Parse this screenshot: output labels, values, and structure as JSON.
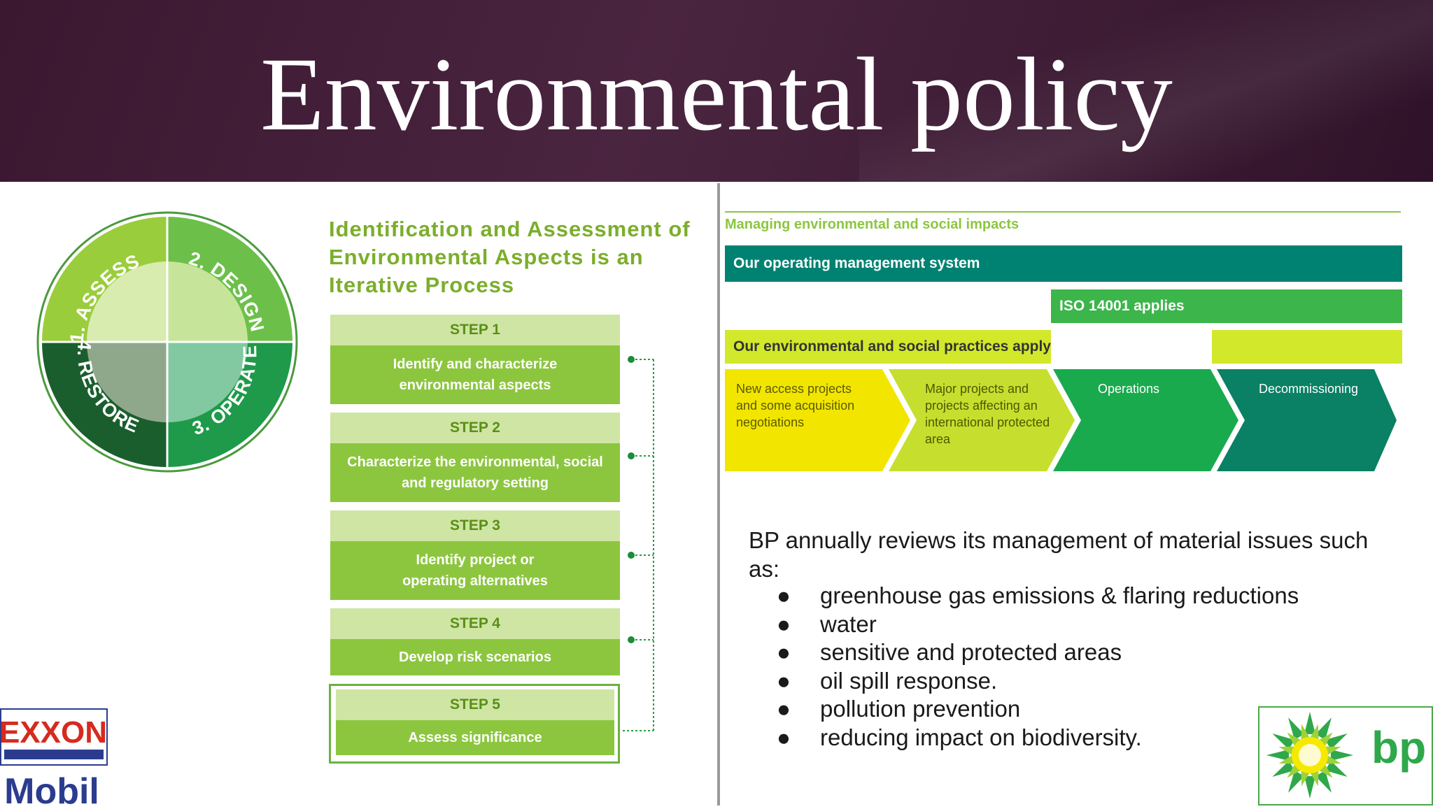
{
  "slide": {
    "title": "Environmental policy"
  },
  "exxon_figure": {
    "wheel": {
      "quadrants": [
        "1. ASSESS",
        "2. DESIGN",
        "3. OPERATE",
        "4. RESTORE"
      ],
      "colors": {
        "assess": "#9acd3c",
        "design": "#5cb85c",
        "operate": "#1e9a4a",
        "restore": "#1b5e2e",
        "inner": "#d9ecb0"
      }
    },
    "heading": "Identification and Assessment of Environmental Aspects is an Iterative Process",
    "steps": [
      {
        "label": "STEP 1",
        "text": "Identify and characterize environmental aspects"
      },
      {
        "label": "STEP 2",
        "text": "Characterize the environmental, social and regulatory setting"
      },
      {
        "label": "STEP 3",
        "text": "Identify project or operating alternatives"
      },
      {
        "label": "STEP 4",
        "text": "Develop risk scenarios"
      },
      {
        "label": "STEP 5",
        "text": "Assess significance"
      }
    ]
  },
  "bp_figure": {
    "heading": "Managing environmental and social impacts",
    "operating_system": "Our operating management system",
    "iso": "ISO 14001 applies",
    "practices": "Our environmental and social practices apply",
    "phases": [
      {
        "label": "New access projects and some acquisition negotiations",
        "color": "#f2e600"
      },
      {
        "label": "Major projects and projects affecting an international protected area",
        "color": "#c6df2e"
      },
      {
        "label": "Operations",
        "color": "#1aaa4e"
      },
      {
        "label": "Decommissioning",
        "color": "#0a8064"
      }
    ]
  },
  "bp_text": {
    "intro": "BP annually reviews its management of material issues such as:",
    "bullet_glyph": "●",
    "items": [
      "greenhouse gas emissions & flaring reductions",
      "water",
      "sensitive and protected areas",
      "oil spill response.",
      "pollution prevention",
      "reducing impact on biodiversity."
    ]
  },
  "logos": {
    "exxon_line1": "EXXON",
    "exxon_line2": "Mobil",
    "bp": "bp"
  }
}
